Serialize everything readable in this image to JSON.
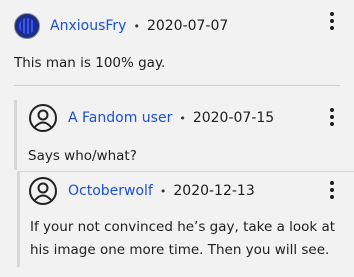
{
  "comments": [
    {
      "user": "AnxiousFry",
      "dot": "•",
      "date": "2020-07-07",
      "text": "This man is 100% gay."
    },
    {
      "user": "A Fandom user",
      "dot": "•",
      "date": "2020-07-15",
      "text": "Says who/what?"
    },
    {
      "user": "Octoberwolf",
      "dot": "•",
      "date": "2020-12-13",
      "text": "If your not convinced he’s gay, take a look at his image one more time. Then you will see."
    }
  ],
  "icons": {
    "menu": "kebab-menu-icon",
    "avatar": "user-circle-icon",
    "image_avatar": "profile-image"
  },
  "colors": {
    "username": "#1b4fd8",
    "background": "#f2f2f2"
  }
}
